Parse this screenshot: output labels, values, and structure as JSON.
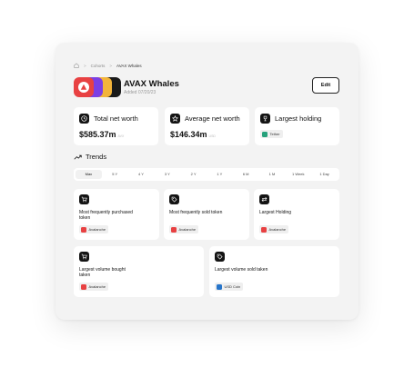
{
  "breadcrumb": {
    "home_icon": "home-icon",
    "items": [
      "Cohorts",
      "AVAX Whales"
    ],
    "separator": ">"
  },
  "header": {
    "title": "AVAX Whales",
    "subtitle": "Added 07/20/23",
    "edit_label": "Edit"
  },
  "stats": [
    {
      "icon": "clock-icon",
      "label": "Total net worth",
      "value": "$585.37m",
      "unit": "AVX"
    },
    {
      "icon": "star-icon",
      "label": "Average net worth",
      "value": "$146.34m",
      "unit": "USD"
    },
    {
      "icon": "trophy-icon",
      "label": "Largest holding",
      "badge": "Tether",
      "badge_color": "#26a17b"
    }
  ],
  "trends": {
    "label": "Trends",
    "icon": "trend-up-icon"
  },
  "tabs": [
    "Max",
    "5 Y",
    "4 Y",
    "3 Y",
    "2 Y",
    "1 Y",
    "6 M",
    "1 M",
    "1 Week",
    "1 Day"
  ],
  "active_tab": "Max",
  "cards": [
    {
      "icon": "cart-icon",
      "label": "Most frequently purchased token",
      "badge": "Avalanche",
      "badge_color": "#e84142"
    },
    {
      "icon": "tag-icon",
      "label": "Most frequently sold token",
      "badge": "Avalanche",
      "badge_color": "#e84142"
    },
    {
      "icon": "swap-icon",
      "label": "Largest Holding",
      "badge": "Avalanche",
      "badge_color": "#e84142"
    },
    {
      "icon": "cart-icon",
      "label": "Largest volume bought taken",
      "badge": "Avalanche",
      "badge_color": "#e84142"
    },
    {
      "icon": "tag-icon",
      "label": "Largest volume sold taken",
      "badge": "USD Coin",
      "badge_color": "#2775ca"
    }
  ],
  "colors": {
    "avalanche": "#e84142",
    "panel": "#f3f3f3",
    "accent_dark": "#141414"
  }
}
